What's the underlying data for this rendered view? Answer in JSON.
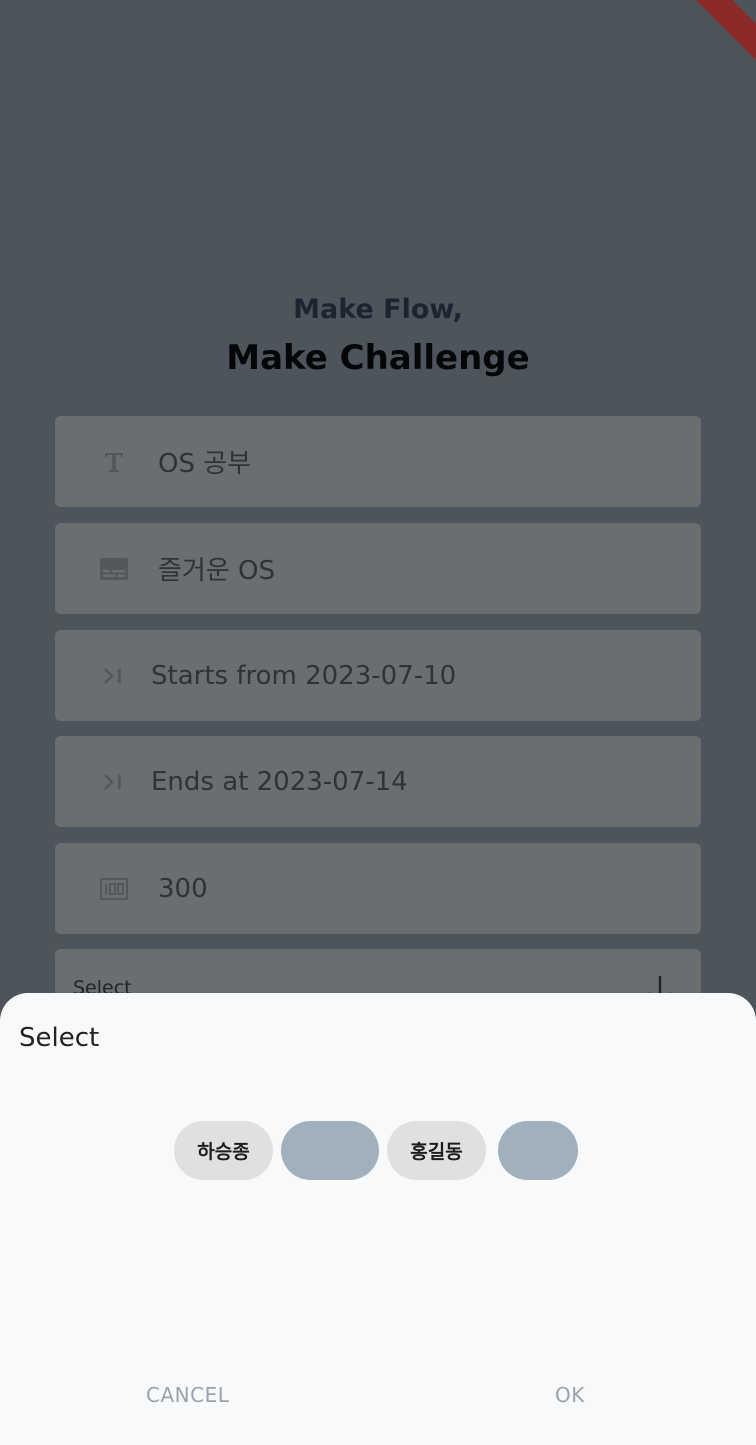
{
  "header": {
    "line1": "Make Flow,",
    "line2": "Make Challenge"
  },
  "form": {
    "title_value": "OS 공부",
    "description_value": "즐거운 OS",
    "start_value": "Starts from 2023-07-10",
    "end_value": "Ends at 2023-07-14",
    "count_value": "300",
    "select_label": "Select"
  },
  "dialog": {
    "title": "Select",
    "chips": [
      {
        "label": "하승종",
        "selected": false
      },
      {
        "label": "",
        "selected": true
      },
      {
        "label": "홍길동",
        "selected": false
      },
      {
        "label": "",
        "selected": true
      }
    ],
    "cancel_label": "CANCEL",
    "ok_label": "OK"
  },
  "icons": {
    "title_field": "text-format-icon",
    "description_field": "subtitles-icon",
    "start_field": "last-page-icon",
    "end_field": "last-page-icon",
    "count_field": "counter-icon",
    "select_field": "arrow-down-icon"
  },
  "colors": {
    "scrim": "#4d545b",
    "field_bg": "#6a6e71",
    "sheet_bg": "#f8f9fa",
    "chip_plain": "#e0e0e0",
    "chip_selected": "#a1b0bd",
    "action_text": "#9aa3ad",
    "debug_banner": "#8a2a2a"
  }
}
